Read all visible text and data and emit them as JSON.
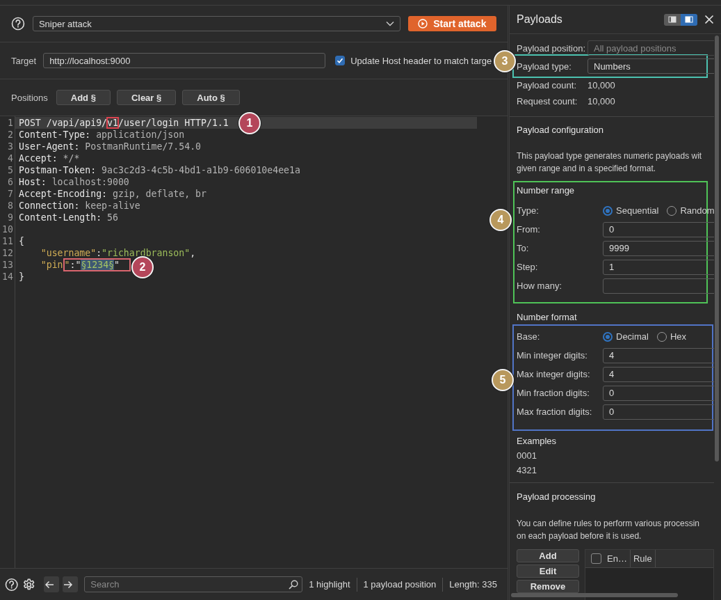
{
  "attack": {
    "mode": "Sniper attack",
    "start_button": "Start attack"
  },
  "target": {
    "label": "Target",
    "url": "http://localhost:9000",
    "update_host": {
      "label": "Update Host header to match targe",
      "checked": true
    }
  },
  "positions": {
    "label": "Positions",
    "buttons": [
      "Add §",
      "Clear §",
      "Auto §"
    ]
  },
  "editor": {
    "lines": [
      {
        "number": "1",
        "current": true,
        "segments": [
          {
            "kind": "name",
            "text": "POST /vapi/api9/"
          },
          {
            "kind": "box",
            "parts": [
              {
                "kind": "name",
                "text": "v1"
              }
            ]
          },
          {
            "kind": "name",
            "text": "/user/login HTTP/1.1"
          }
        ]
      },
      {
        "number": "2",
        "current": false,
        "segments": [
          {
            "kind": "name",
            "text": "Content-Type: "
          },
          {
            "kind": "value",
            "text": "application/json"
          }
        ]
      },
      {
        "number": "3",
        "current": false,
        "segments": [
          {
            "kind": "name",
            "text": "User-Agent: "
          },
          {
            "kind": "value",
            "text": "PostmanRuntime/7.54.0"
          }
        ]
      },
      {
        "number": "4",
        "current": false,
        "segments": [
          {
            "kind": "name",
            "text": "Accept: "
          },
          {
            "kind": "value",
            "text": "*/*"
          }
        ]
      },
      {
        "number": "5",
        "current": false,
        "segments": [
          {
            "kind": "name",
            "text": "Postman-Token: "
          },
          {
            "kind": "value",
            "text": "9ac3c2d3-4c5b-4bd1-a1b9-606010e4ee1a"
          }
        ]
      },
      {
        "number": "6",
        "current": false,
        "segments": [
          {
            "kind": "name",
            "text": "Host: "
          },
          {
            "kind": "value",
            "text": "localhost:9000"
          }
        ]
      },
      {
        "number": "7",
        "current": false,
        "segments": [
          {
            "kind": "name",
            "text": "Accept-Encoding: "
          },
          {
            "kind": "value",
            "text": "gzip, deflate, br"
          }
        ]
      },
      {
        "number": "8",
        "current": false,
        "segments": [
          {
            "kind": "name",
            "text": "Connection: "
          },
          {
            "kind": "value",
            "text": "keep-alive"
          }
        ]
      },
      {
        "number": "9",
        "current": false,
        "segments": [
          {
            "kind": "name",
            "text": "Content-Length: "
          },
          {
            "kind": "value",
            "text": "56"
          }
        ]
      },
      {
        "number": "10",
        "current": false
      },
      {
        "number": "11",
        "current": false,
        "segments": [
          {
            "kind": "punct",
            "text": "{"
          }
        ]
      },
      {
        "number": "12",
        "current": false,
        "segments": [
          {
            "kind": "key",
            "text": "    \"username\""
          },
          {
            "kind": "punct",
            "text": ":"
          },
          {
            "kind": "string",
            "text": "\"richardbranson\""
          },
          {
            "kind": "punct",
            "text": ","
          }
        ]
      },
      {
        "number": "13",
        "current": false,
        "segments": [
          {
            "kind": "key",
            "text": "    \"pin"
          },
          {
            "kind": "box",
            "parts": [
              {
                "kind": "key",
                "text": "\""
              },
              {
                "kind": "punct",
                "text": ":\""
              },
              {
                "kind": "payload",
                "text": "§1234§"
              },
              {
                "kind": "punct",
                "text": "\""
              }
            ]
          }
        ]
      },
      {
        "number": "14",
        "current": false,
        "segments": [
          {
            "kind": "punct",
            "text": "}"
          }
        ]
      }
    ]
  },
  "status_bar": {
    "search_placeholder": "Search",
    "items": [
      "1 highlight",
      "1 payload position",
      "Length: 335"
    ]
  },
  "payloads": {
    "title": "Payloads",
    "layout_toggle": [
      {
        "selected": false
      },
      {
        "selected": true
      }
    ],
    "fields": [
      {
        "label": "Payload position:",
        "value": "All payload positions",
        "disabled": true
      },
      {
        "label": "Payload type:",
        "value": "Numbers",
        "disabled": false
      }
    ],
    "counts": [
      {
        "label": "Payload count:",
        "value": "10,000"
      },
      {
        "label": "Request count:",
        "value": "10,000"
      }
    ],
    "configuration": {
      "title": "Payload configuration",
      "description": [
        "This payload type generates numeric payloads wit",
        "given range and in a specified format."
      ]
    },
    "number_range": {
      "title": "Number range",
      "type": {
        "label": "Type:",
        "options": [
          {
            "label": "Sequential",
            "selected": true
          },
          {
            "label": "Random",
            "selected": false
          }
        ]
      },
      "fields": [
        {
          "label": "From:",
          "value": "0"
        },
        {
          "label": "To:",
          "value": "9999"
        },
        {
          "label": "Step:",
          "value": "1"
        },
        {
          "label": "How many:"
        }
      ]
    },
    "number_format": {
      "title": "Number format",
      "base": {
        "label": "Base:",
        "options": [
          {
            "label": "Decimal",
            "selected": true
          },
          {
            "label": "Hex",
            "selected": false
          }
        ]
      },
      "fields": [
        {
          "label": "Min integer digits:",
          "value": "4"
        },
        {
          "label": "Max integer digits:",
          "value": "4"
        },
        {
          "label": "Min fraction digits:",
          "value": "0"
        },
        {
          "label": "Max fraction digits:",
          "value": "0"
        }
      ]
    },
    "examples": {
      "title": "Examples",
      "values": [
        "0001",
        "4321"
      ]
    },
    "processing": {
      "title": "Payload processing",
      "description": [
        "You can define rules to perform various processin",
        "on each payload before it is used."
      ],
      "buttons": [
        "Add",
        "Edit",
        "Remove"
      ],
      "table": {
        "select_all": {
          "checked": false
        },
        "columns": [
          "En…",
          "Rule"
        ]
      }
    }
  },
  "annotations": [
    {
      "label": "1",
      "color": "#b4465a"
    },
    {
      "label": "2",
      "color": "#b4465a"
    },
    {
      "label": "3",
      "color": "#b8985c"
    },
    {
      "label": "4",
      "color": "#b8985c"
    },
    {
      "label": "5",
      "color": "#b8985c"
    }
  ]
}
